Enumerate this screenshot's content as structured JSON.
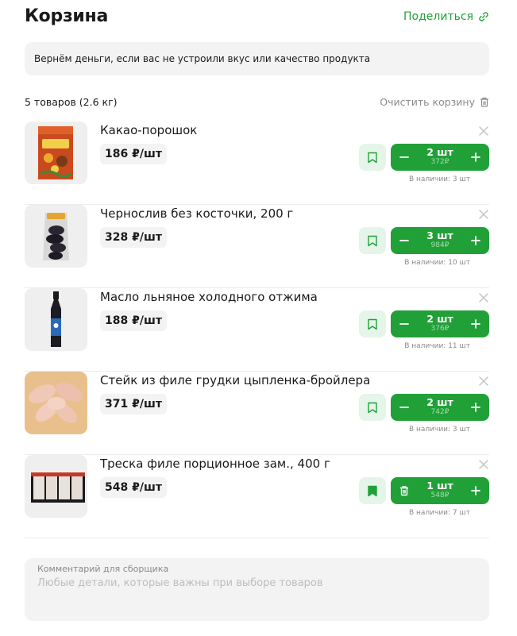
{
  "header": {
    "title": "Корзина",
    "share_label": "Поделиться",
    "share_icon": "link-icon"
  },
  "banner": {
    "text": "Вернём деньги, если вас не устроили вкус или качество продукта"
  },
  "summary": {
    "count_label": "5 товаров (2.6 кг)",
    "clear_label": "Очистить корзину",
    "clear_icon": "trash-icon"
  },
  "items": [
    {
      "name": "Какао-порошок",
      "price": "186 ₽/шт",
      "qty": "2 шт",
      "total": "372₽",
      "stock": "В наличии: 3 шт",
      "favorited": false,
      "image": "cocoa-box-image"
    },
    {
      "name": "Чернослив без косточки, 200 г",
      "price": "328 ₽/шт",
      "qty": "3 шт",
      "total": "984₽",
      "stock": "В наличии: 10 шт",
      "favorited": false,
      "image": "prunes-pack-image"
    },
    {
      "name": "Масло льняное холодного отжима",
      "price": "188 ₽/шт",
      "qty": "2 шт",
      "total": "376₽",
      "stock": "В наличии: 11 шт",
      "favorited": false,
      "image": "oil-bottle-image"
    },
    {
      "name": "Стейк из филе грудки цыпленка-бройлера",
      "price": "371 ₽/шт",
      "qty": "2 шт",
      "total": "742₽",
      "stock": "В наличии: 3 шт",
      "favorited": false,
      "image": "chicken-fillet-image"
    },
    {
      "name": "Треска филе порционное зам., 400 г",
      "price": "548 ₽/шт",
      "qty": "1 шт",
      "total": "548₽",
      "stock": "В наличии: 7 шт",
      "favorited": true,
      "image": "cod-fillet-image"
    }
  ],
  "comment": {
    "label": "Комментарий для сборщика",
    "placeholder": "Любые детали, которые важны при выборе товаров"
  },
  "colors": {
    "accent": "#21a038",
    "accent_light": "#e5f5e9",
    "muted": "#8a8a8a",
    "surface": "#f3f3f3"
  }
}
